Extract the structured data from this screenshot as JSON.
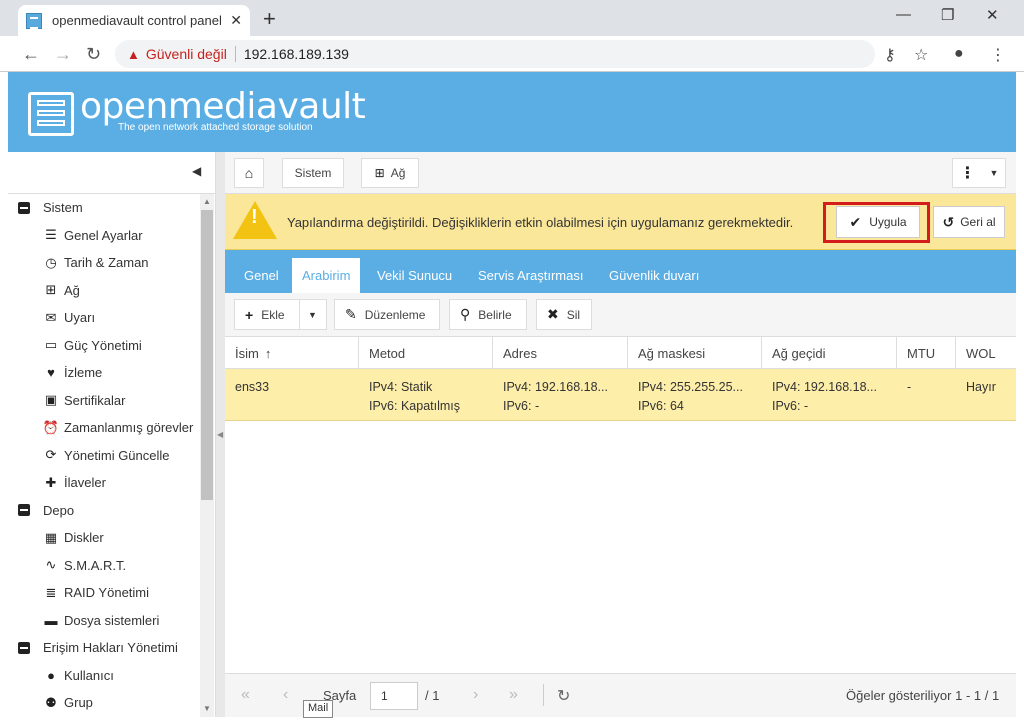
{
  "browser": {
    "tab_title": "openmediavault control panel - ",
    "tab_close": "✕",
    "new_tab": "+",
    "security_label": "Güvenli değil",
    "url": "192.168.189.139"
  },
  "app": {
    "logo_name": "openmediavault",
    "logo_tagline": "The open network attached storage solution"
  },
  "breadcrumb": {
    "sistem": "Sistem",
    "ag": "Ağ"
  },
  "sidebar": {
    "groups": [
      {
        "label": "Sistem",
        "items": [
          {
            "label": "Genel Ayarlar",
            "icon": "sliders-icon"
          },
          {
            "label": "Tarih & Zaman",
            "icon": "clock-icon"
          },
          {
            "label": "Ağ",
            "icon": "network-icon"
          },
          {
            "label": "Uyarı",
            "icon": "envelope-icon"
          },
          {
            "label": "Güç Yönetimi",
            "icon": "battery-icon"
          },
          {
            "label": "İzleme",
            "icon": "heartbeat-icon"
          },
          {
            "label": "Sertifikalar",
            "icon": "certificate-icon"
          },
          {
            "label": "Zamanlanmış görevler",
            "icon": "alarm-icon"
          },
          {
            "label": "Yönetimi Güncelle",
            "icon": "refresh-icon"
          },
          {
            "label": "İlaveler",
            "icon": "puzzle-icon"
          }
        ]
      },
      {
        "label": "Depo",
        "items": [
          {
            "label": "Diskler",
            "icon": "disk-icon"
          },
          {
            "label": "S.M.A.R.T.",
            "icon": "pulse-icon"
          },
          {
            "label": "RAID Yönetimi",
            "icon": "database-icon"
          },
          {
            "label": "Dosya sistemleri",
            "icon": "folder-icon"
          }
        ]
      },
      {
        "label": "Erişim Hakları Yönetimi",
        "items": [
          {
            "label": "Kullanıcı",
            "icon": "user-icon"
          },
          {
            "label": "Grup",
            "icon": "users-icon"
          }
        ]
      }
    ]
  },
  "notice": {
    "text": "Yapılandırma değiştirildi. Değişikliklerin etkin olabilmesi için uygulamanız gerekmektedir.",
    "apply_label": "Uygula",
    "revert_label": "Geri al"
  },
  "tabs": [
    "Genel",
    "Arabirim",
    "Vekil Sunucu",
    "Servis Araştırması",
    "Güvenlik duvarı"
  ],
  "active_tab": "Arabirim",
  "grid_toolbar": {
    "add": "Ekle",
    "edit": "Düzenleme",
    "identify": "Belirle",
    "delete": "Sil"
  },
  "table": {
    "columns": [
      "İsim",
      "Metod",
      "Adres",
      "Ağ maskesi",
      "Ağ geçidi",
      "MTU",
      "WOL"
    ],
    "sort_indicator": "↑",
    "rows": [
      {
        "name": "ens33",
        "method_v4": "IPv4: Statik",
        "method_v6": "IPv6: Kapatılmış",
        "address_v4": "IPv4: 192.168.18...",
        "address_v6": "IPv6: -",
        "netmask_v4": "IPv4: 255.255.25...",
        "netmask_v6": "IPv6: 64",
        "gateway_v4": "IPv4: 192.168.18...",
        "gateway_v6": "IPv6: -",
        "mtu": "-",
        "wol": "Hayır"
      }
    ]
  },
  "paging": {
    "page_label": "Sayfa",
    "page_value": "1",
    "page_total": "/ 1",
    "summary": "Öğeler gösteriliyor 1 - 1 / 1"
  },
  "tooltip": "Mail",
  "colors": {
    "accent": "#5aaee4",
    "notice": "#fbe79a",
    "highlight": "#d41c1c",
    "row_selected": "#fdeeaa"
  }
}
